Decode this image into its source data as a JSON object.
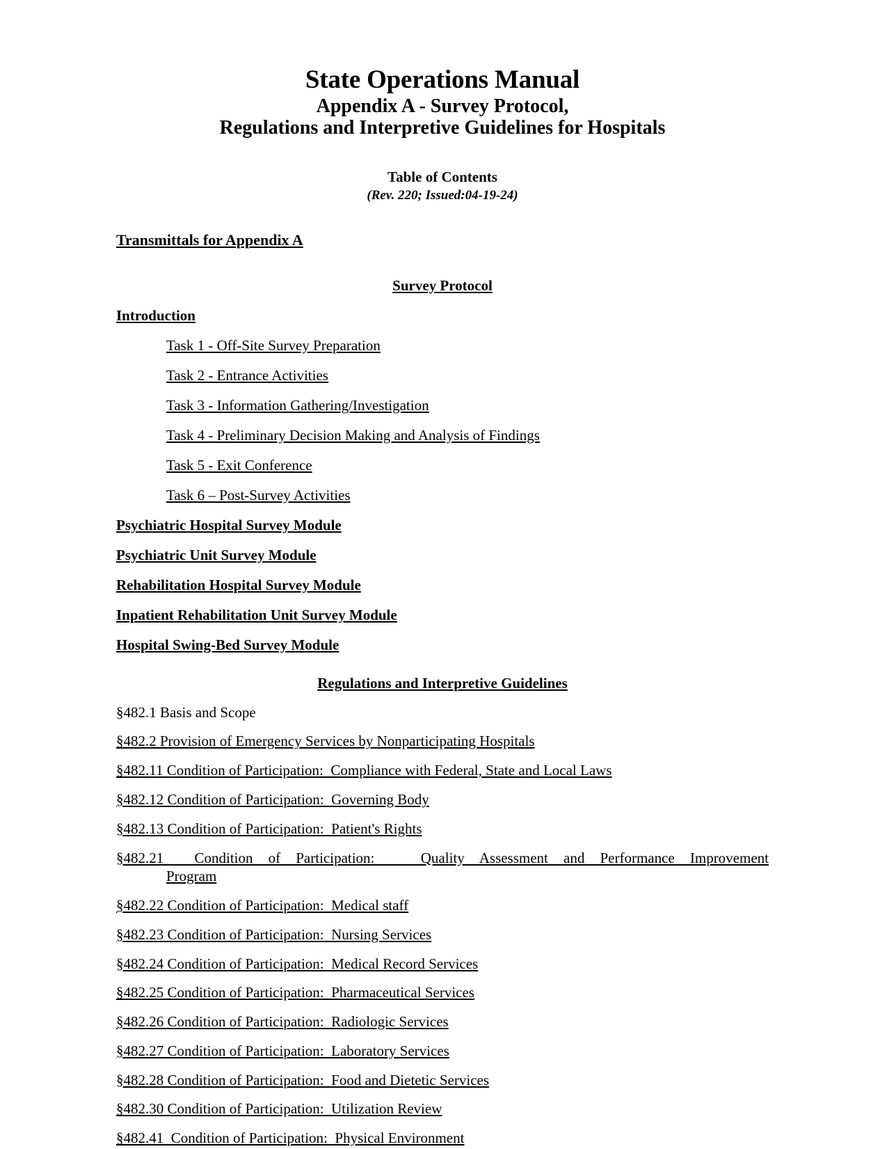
{
  "document": {
    "title": "State Operations Manual",
    "subtitle_line_1": "Appendix A - Survey Protocol,",
    "subtitle_line_2": "Regulations and Interpretive Guidelines for Hospitals",
    "toc_label": "Table of Contents",
    "revision": "(Rev. 220; Issued:04-19-24)"
  },
  "transmittals": {
    "label": "Transmittals for Appendix A"
  },
  "survey_protocol": {
    "heading": "Survey Protocol",
    "introduction_label": "Introduction",
    "tasks": [
      {
        "label": "Task 1 - Off-Site Survey Preparation"
      },
      {
        "label": "Task 2 - Entrance Activities"
      },
      {
        "label": "Task 3 - Information Gathering/Investigation"
      },
      {
        "label": "Task 4 - Preliminary Decision Making and Analysis of Findings"
      },
      {
        "label": "Task 5 - Exit Conference"
      },
      {
        "label": "Task 6 – Post-Survey Activities"
      }
    ],
    "modules": [
      {
        "label": "Psychiatric Hospital Survey Module"
      },
      {
        "label": "Psychiatric Unit Survey Module"
      },
      {
        "label": "Rehabilitation Hospital Survey Module"
      },
      {
        "label": "Inpatient Rehabilitation Unit Survey Module"
      },
      {
        "label": "Hospital Swing-Bed Survey Module"
      }
    ]
  },
  "regulations": {
    "heading": "Regulations and Interpretive Guidelines",
    "entries": [
      {
        "label": "§482.1 Basis and Scope"
      },
      {
        "label": "§482.2 Provision of Emergency Services by Nonparticipating Hospitals"
      },
      {
        "label": "§482.11 Condition of Participation:  Compliance with Federal, State and Local Laws"
      },
      {
        "label": "§482.12 Condition of Participation:  Governing Body"
      },
      {
        "label": "§482.13 Condition of Participation:  Patient's Rights"
      },
      {
        "line1": "§482.21  Condition of Participation:   Quality Assessment and Performance Improvement",
        "line2": "Program"
      },
      {
        "label": "§482.22 Condition of Participation:  Medical staff"
      },
      {
        "label": "§482.23 Condition of Participation:  Nursing Services"
      },
      {
        "label": "§482.24 Condition of Participation:  Medical Record Services"
      },
      {
        "label": "§482.25 Condition of Participation:  Pharmaceutical Services"
      },
      {
        "label": "§482.26 Condition of Participation:  Radiologic Services"
      },
      {
        "label": "§482.27 Condition of Participation:  Laboratory Services"
      },
      {
        "label": "§482.28 Condition of Participation:  Food and Dietetic Services"
      },
      {
        "label": "§482.30 Condition of Participation:  Utilization Review"
      },
      {
        "label": "§482.41  Condition of Participation:  Physical Environment"
      }
    ]
  }
}
